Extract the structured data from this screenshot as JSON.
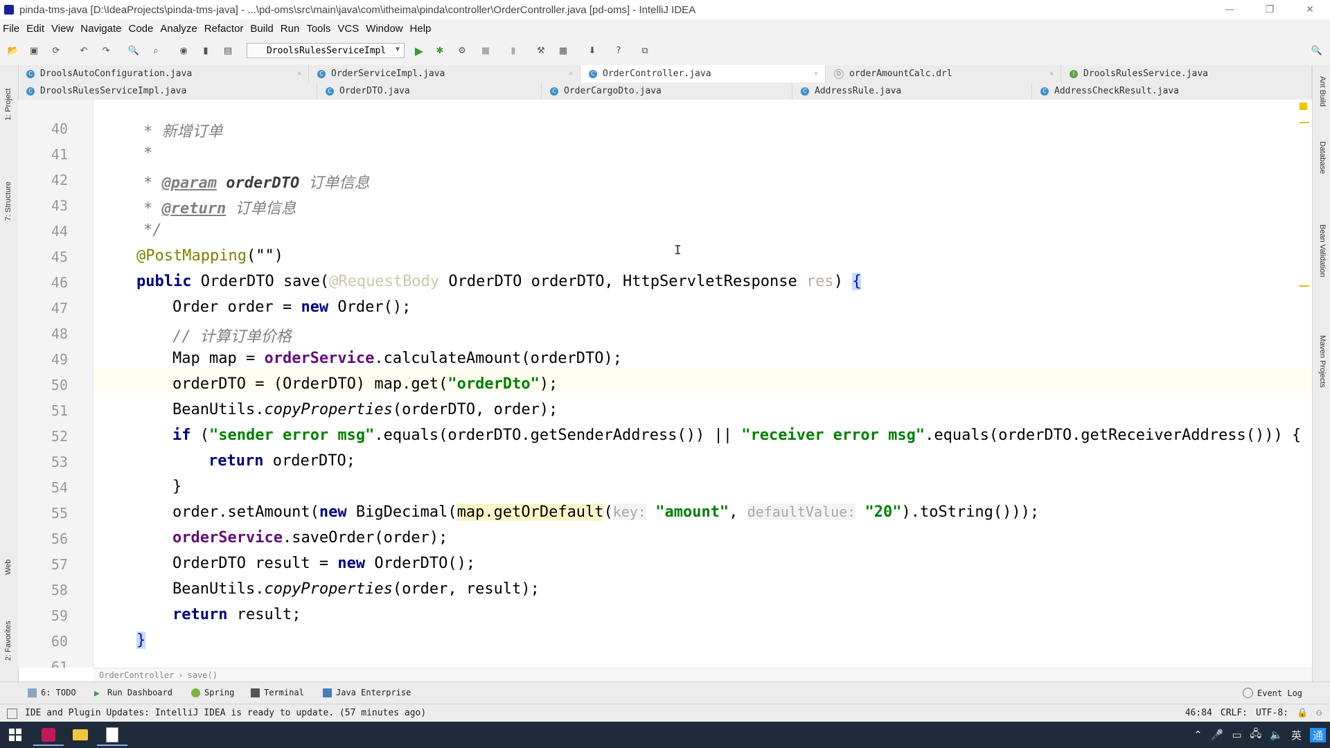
{
  "window": {
    "title": "pinda-tms-java [D:\\IdeaProjects\\pinda-tms-java] - ...\\pd-oms\\src\\main\\java\\com\\itheima\\pinda\\controller\\OrderController.java [pd-oms] - IntelliJ IDEA",
    "minimize": "—",
    "maximize": "❐",
    "close": "✕"
  },
  "menu": [
    "File",
    "Edit",
    "View",
    "Navigate",
    "Code",
    "Analyze",
    "Refactor",
    "Build",
    "Run",
    "Tools",
    "VCS",
    "Window",
    "Help"
  ],
  "toolbar": {
    "run_config": "DroolsRulesServiceImpl"
  },
  "tabs_row1": [
    {
      "label": "DroolsAutoConfiguration.java",
      "icon": "class",
      "active": false
    },
    {
      "label": "OrderServiceImpl.java",
      "icon": "class",
      "active": false
    },
    {
      "label": "OrderController.java",
      "icon": "class",
      "active": true
    },
    {
      "label": "orderAmountCalc.drl",
      "icon": "drl",
      "active": false
    },
    {
      "label": "DroolsRulesService.java",
      "icon": "interface",
      "active": false
    }
  ],
  "tabs_row2": [
    {
      "label": "DroolsRulesServiceImpl.java",
      "icon": "class"
    },
    {
      "label": "OrderDTO.java",
      "icon": "class"
    },
    {
      "label": "OrderCargoDto.java",
      "icon": "class"
    },
    {
      "label": "AddressRule.java",
      "icon": "class"
    },
    {
      "label": "AddressCheckResult.java",
      "icon": "class"
    }
  ],
  "left_tools": [
    "1: Project",
    "7: Structure",
    "Web",
    "2: Favorites"
  ],
  "right_tools": [
    "Ant Build",
    "Database",
    "Bean Validation",
    "Maven Projects"
  ],
  "line_numbers": [
    "40",
    "41",
    "42",
    "43",
    "44",
    "45",
    "46",
    "47",
    "48",
    "49",
    "50",
    "51",
    "52",
    "53",
    "54",
    "55",
    "56",
    "57",
    "58",
    "59",
    "60",
    "61"
  ],
  "code": {
    "l40": "新增订单",
    "l42_tag": "@param",
    "l42_name": "orderDTO",
    "l42_desc": "订单信息",
    "l43_tag": "@return",
    "l43_desc": "订单信息",
    "l45_ann": "@PostMapping",
    "l45_arg": "(\"\")",
    "l46_kw": "public",
    "l46_a": "OrderDTO save(",
    "l46_ann": "@RequestBody",
    "l46_b": " OrderDTO orderDTO, HttpServletResponse ",
    "l46_unused": "res",
    "l46_c": ") ",
    "l46_brace": "{",
    "l47_a": "Order order = ",
    "l47_kw": "new",
    "l47_b": " Order();",
    "l48": "// 计算订单价格",
    "l49_a": "Map map = ",
    "l49_fld": "orderService",
    "l49_b": ".calculateAmount(orderDTO);",
    "l50_a": "orderDTO = (OrderDTO) map.get(",
    "l50_str": "\"orderDto\"",
    "l50_b": ");",
    "l51_a": "BeanUtils.",
    "l51_stat": "copyProperties",
    "l51_b": "(orderDTO, order);",
    "l52_kw": "if",
    "l52_a": " (",
    "l52_str1": "\"sender error msg\"",
    "l52_b": ".equals(orderDTO.getSenderAddress()) || ",
    "l52_str2": "\"receiver error msg\"",
    "l52_c": ".equals(orderDTO.getReceiverAddress())) {",
    "l53_kw": "return",
    "l53_a": " orderDTO;",
    "l54": "}",
    "l55_a": "order.setAmount(",
    "l55_kw": "new",
    "l55_b": " BigDecimal(",
    "l55_hl": "map.getOrDefault",
    "l55_c": "(",
    "l55_hint1": "key:",
    "l55_str1": "\"amount\"",
    "l55_d": ", ",
    "l55_hint2": "defaultValue:",
    "l55_str2": "\"20\"",
    "l55_e": ").toString()));",
    "l56_fld": "orderService",
    "l56_a": ".saveOrder(order);",
    "l57_a": "OrderDTO result = ",
    "l57_kw": "new",
    "l57_b": " OrderDTO();",
    "l58_a": "BeanUtils.",
    "l58_stat": "copyProperties",
    "l58_b": "(order, result);",
    "l59_kw": "return",
    "l59_a": " result;",
    "l60": "}"
  },
  "breadcrumb": [
    "OrderController",
    "save()"
  ],
  "tool_windows": [
    "6: TODO",
    "Run Dashboard",
    "Spring",
    "Terminal",
    "Java Enterprise"
  ],
  "event_log": "Event Log",
  "status": {
    "message": "IDE and Plugin Updates: IntelliJ IDEA is ready to update. (57 minutes ago)",
    "position": "46:84",
    "line_sep": "CRLF:",
    "encoding": "UTF-8:"
  },
  "taskbar": {
    "ime": "英",
    "notif": "通"
  }
}
